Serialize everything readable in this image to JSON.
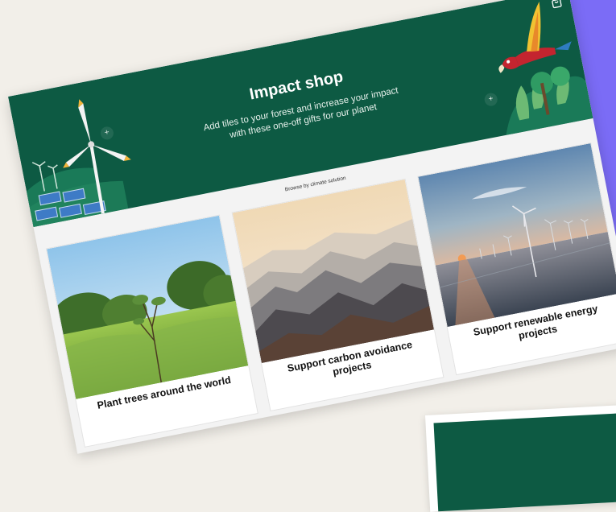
{
  "header": {
    "title": "Impact shop",
    "subtitle_line1": "Add tiles to your forest and increase your impact",
    "subtitle_line2": "with these one-off gifts for our planet",
    "plus_symbol": "+"
  },
  "browse_label": "Browse by climate solution",
  "tiles": [
    {
      "label": "Plant trees around the world"
    },
    {
      "label": "Support carbon avoidance projects"
    },
    {
      "label": "Support renewable energy projects"
    }
  ],
  "colors": {
    "hero_green": "#0d5a43",
    "accent_purple": "#7b6cf6",
    "page_bg": "#f2efe9"
  }
}
